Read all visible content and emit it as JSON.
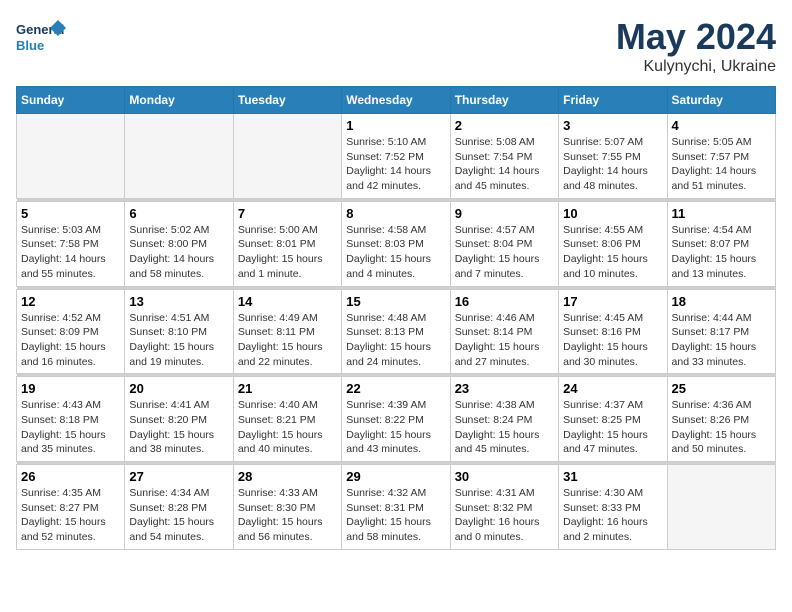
{
  "logo": {
    "line1": "General",
    "line2": "Blue"
  },
  "title": "May 2024",
  "subtitle": "Kulynychi, Ukraine",
  "weekdays": [
    "Sunday",
    "Monday",
    "Tuesday",
    "Wednesday",
    "Thursday",
    "Friday",
    "Saturday"
  ],
  "weeks": [
    [
      {
        "day": "",
        "sunrise": "",
        "sunset": "",
        "daylight": ""
      },
      {
        "day": "",
        "sunrise": "",
        "sunset": "",
        "daylight": ""
      },
      {
        "day": "",
        "sunrise": "",
        "sunset": "",
        "daylight": ""
      },
      {
        "day": "1",
        "sunrise": "Sunrise: 5:10 AM",
        "sunset": "Sunset: 7:52 PM",
        "daylight": "Daylight: 14 hours and 42 minutes."
      },
      {
        "day": "2",
        "sunrise": "Sunrise: 5:08 AM",
        "sunset": "Sunset: 7:54 PM",
        "daylight": "Daylight: 14 hours and 45 minutes."
      },
      {
        "day": "3",
        "sunrise": "Sunrise: 5:07 AM",
        "sunset": "Sunset: 7:55 PM",
        "daylight": "Daylight: 14 hours and 48 minutes."
      },
      {
        "day": "4",
        "sunrise": "Sunrise: 5:05 AM",
        "sunset": "Sunset: 7:57 PM",
        "daylight": "Daylight: 14 hours and 51 minutes."
      }
    ],
    [
      {
        "day": "5",
        "sunrise": "Sunrise: 5:03 AM",
        "sunset": "Sunset: 7:58 PM",
        "daylight": "Daylight: 14 hours and 55 minutes."
      },
      {
        "day": "6",
        "sunrise": "Sunrise: 5:02 AM",
        "sunset": "Sunset: 8:00 PM",
        "daylight": "Daylight: 14 hours and 58 minutes."
      },
      {
        "day": "7",
        "sunrise": "Sunrise: 5:00 AM",
        "sunset": "Sunset: 8:01 PM",
        "daylight": "Daylight: 15 hours and 1 minute."
      },
      {
        "day": "8",
        "sunrise": "Sunrise: 4:58 AM",
        "sunset": "Sunset: 8:03 PM",
        "daylight": "Daylight: 15 hours and 4 minutes."
      },
      {
        "day": "9",
        "sunrise": "Sunrise: 4:57 AM",
        "sunset": "Sunset: 8:04 PM",
        "daylight": "Daylight: 15 hours and 7 minutes."
      },
      {
        "day": "10",
        "sunrise": "Sunrise: 4:55 AM",
        "sunset": "Sunset: 8:06 PM",
        "daylight": "Daylight: 15 hours and 10 minutes."
      },
      {
        "day": "11",
        "sunrise": "Sunrise: 4:54 AM",
        "sunset": "Sunset: 8:07 PM",
        "daylight": "Daylight: 15 hours and 13 minutes."
      }
    ],
    [
      {
        "day": "12",
        "sunrise": "Sunrise: 4:52 AM",
        "sunset": "Sunset: 8:09 PM",
        "daylight": "Daylight: 15 hours and 16 minutes."
      },
      {
        "day": "13",
        "sunrise": "Sunrise: 4:51 AM",
        "sunset": "Sunset: 8:10 PM",
        "daylight": "Daylight: 15 hours and 19 minutes."
      },
      {
        "day": "14",
        "sunrise": "Sunrise: 4:49 AM",
        "sunset": "Sunset: 8:11 PM",
        "daylight": "Daylight: 15 hours and 22 minutes."
      },
      {
        "day": "15",
        "sunrise": "Sunrise: 4:48 AM",
        "sunset": "Sunset: 8:13 PM",
        "daylight": "Daylight: 15 hours and 24 minutes."
      },
      {
        "day": "16",
        "sunrise": "Sunrise: 4:46 AM",
        "sunset": "Sunset: 8:14 PM",
        "daylight": "Daylight: 15 hours and 27 minutes."
      },
      {
        "day": "17",
        "sunrise": "Sunrise: 4:45 AM",
        "sunset": "Sunset: 8:16 PM",
        "daylight": "Daylight: 15 hours and 30 minutes."
      },
      {
        "day": "18",
        "sunrise": "Sunrise: 4:44 AM",
        "sunset": "Sunset: 8:17 PM",
        "daylight": "Daylight: 15 hours and 33 minutes."
      }
    ],
    [
      {
        "day": "19",
        "sunrise": "Sunrise: 4:43 AM",
        "sunset": "Sunset: 8:18 PM",
        "daylight": "Daylight: 15 hours and 35 minutes."
      },
      {
        "day": "20",
        "sunrise": "Sunrise: 4:41 AM",
        "sunset": "Sunset: 8:20 PM",
        "daylight": "Daylight: 15 hours and 38 minutes."
      },
      {
        "day": "21",
        "sunrise": "Sunrise: 4:40 AM",
        "sunset": "Sunset: 8:21 PM",
        "daylight": "Daylight: 15 hours and 40 minutes."
      },
      {
        "day": "22",
        "sunrise": "Sunrise: 4:39 AM",
        "sunset": "Sunset: 8:22 PM",
        "daylight": "Daylight: 15 hours and 43 minutes."
      },
      {
        "day": "23",
        "sunrise": "Sunrise: 4:38 AM",
        "sunset": "Sunset: 8:24 PM",
        "daylight": "Daylight: 15 hours and 45 minutes."
      },
      {
        "day": "24",
        "sunrise": "Sunrise: 4:37 AM",
        "sunset": "Sunset: 8:25 PM",
        "daylight": "Daylight: 15 hours and 47 minutes."
      },
      {
        "day": "25",
        "sunrise": "Sunrise: 4:36 AM",
        "sunset": "Sunset: 8:26 PM",
        "daylight": "Daylight: 15 hours and 50 minutes."
      }
    ],
    [
      {
        "day": "26",
        "sunrise": "Sunrise: 4:35 AM",
        "sunset": "Sunset: 8:27 PM",
        "daylight": "Daylight: 15 hours and 52 minutes."
      },
      {
        "day": "27",
        "sunrise": "Sunrise: 4:34 AM",
        "sunset": "Sunset: 8:28 PM",
        "daylight": "Daylight: 15 hours and 54 minutes."
      },
      {
        "day": "28",
        "sunrise": "Sunrise: 4:33 AM",
        "sunset": "Sunset: 8:30 PM",
        "daylight": "Daylight: 15 hours and 56 minutes."
      },
      {
        "day": "29",
        "sunrise": "Sunrise: 4:32 AM",
        "sunset": "Sunset: 8:31 PM",
        "daylight": "Daylight: 15 hours and 58 minutes."
      },
      {
        "day": "30",
        "sunrise": "Sunrise: 4:31 AM",
        "sunset": "Sunset: 8:32 PM",
        "daylight": "Daylight: 16 hours and 0 minutes."
      },
      {
        "day": "31",
        "sunrise": "Sunrise: 4:30 AM",
        "sunset": "Sunset: 8:33 PM",
        "daylight": "Daylight: 16 hours and 2 minutes."
      },
      {
        "day": "",
        "sunrise": "",
        "sunset": "",
        "daylight": ""
      }
    ]
  ]
}
